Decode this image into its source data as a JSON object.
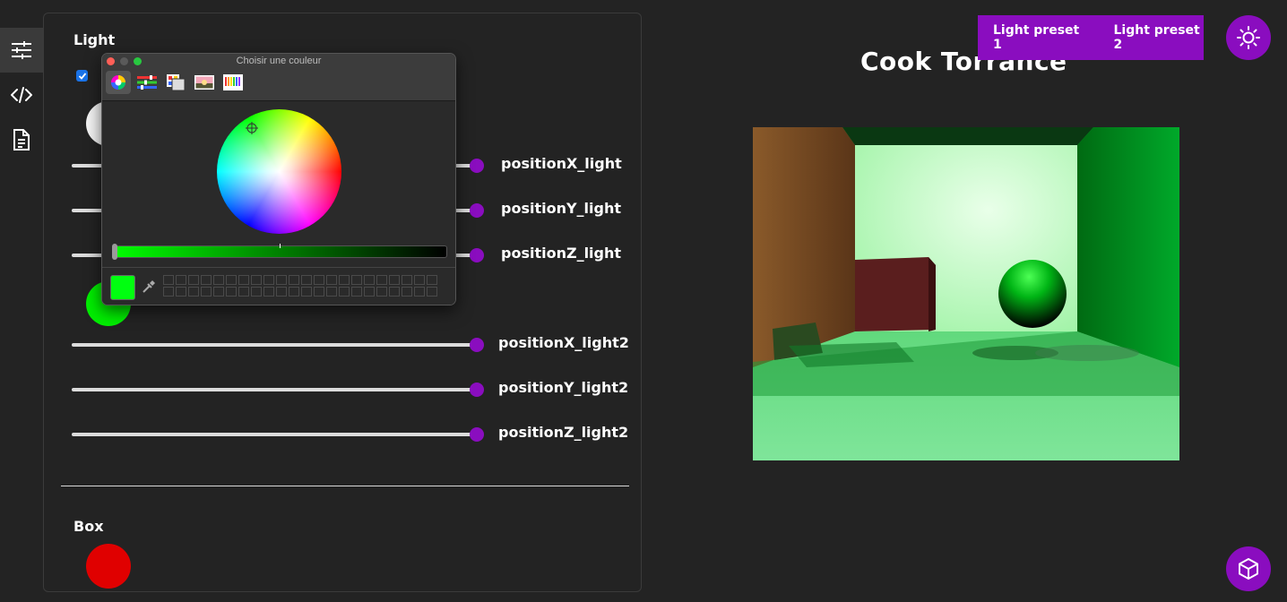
{
  "sidebar": {
    "items": [
      {
        "name": "controls",
        "icon": "sliders-icon",
        "active": true
      },
      {
        "name": "code",
        "icon": "code-icon",
        "active": false
      },
      {
        "name": "document",
        "icon": "document-icon",
        "active": false
      }
    ]
  },
  "panel": {
    "light_section": {
      "title": "Light",
      "checkbox_checked": true,
      "color1": "#ffffff",
      "color2": "#00ff00",
      "sliders": [
        {
          "label": "positionX_light",
          "value": 1.0
        },
        {
          "label": "positionY_light",
          "value": 1.0
        },
        {
          "label": "positionZ_light",
          "value": 1.0
        },
        {
          "label": "positionX_light2",
          "value": 1.0
        },
        {
          "label": "positionY_light2",
          "value": 1.0
        },
        {
          "label": "positionZ_light2",
          "value": 1.0
        }
      ]
    },
    "box_section": {
      "title": "Box",
      "color": "#e00000"
    }
  },
  "color_picker": {
    "title": "Choisir une couleur",
    "modes": [
      "color-wheel-icon",
      "color-sliders-icon",
      "color-palettes-icon",
      "image-palettes-icon",
      "pencils-icon"
    ],
    "selected_mode": "color-wheel-icon",
    "current_color": "#00ff10"
  },
  "viewport": {
    "heading": "Cook Torrance",
    "presets": [
      "Light preset 1",
      "Light preset 2"
    ],
    "accent": "#8a0dbf",
    "theme_icon": "sun-icon",
    "bottom_icon": "cube-icon"
  }
}
